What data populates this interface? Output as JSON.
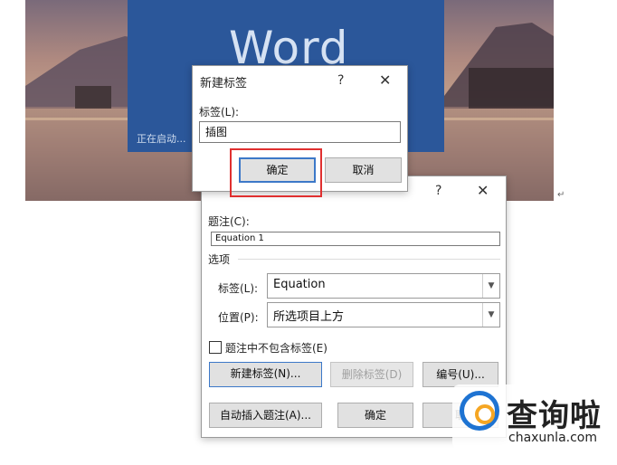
{
  "splash": {
    "title": "Word",
    "status": "正在启动..."
  },
  "new_label_dialog": {
    "title": "新建标签",
    "help": "?",
    "close": "✕",
    "label_caption": "标签(L):",
    "label_value": "插图",
    "ok_label": "确定",
    "cancel_label": "取消"
  },
  "caption_dialog": {
    "help": "?",
    "close": "✕",
    "caption_label": "题注(C):",
    "caption_value": "Equation 1",
    "options_label": "选项",
    "label_field_label": "标签(L):",
    "label_field_value": "Equation",
    "position_label": "位置(P):",
    "position_value": "所选项目上方",
    "exclude_label_checkbox": "题注中不包含标签(E)",
    "new_label_button": "新建标签(N)...",
    "delete_label_button": "删除标签(D)",
    "numbering_button": "编号(U)...",
    "autocaption_button": "自动插入题注(A)...",
    "ok_button": "确定",
    "cancel_button": "取"
  },
  "watermark": {
    "name": "查询啦",
    "url": "chaxunla.com"
  },
  "colors": {
    "word_blue": "#2b579a",
    "highlight_red": "#e03030",
    "default_button_border": "#3c78c8"
  }
}
